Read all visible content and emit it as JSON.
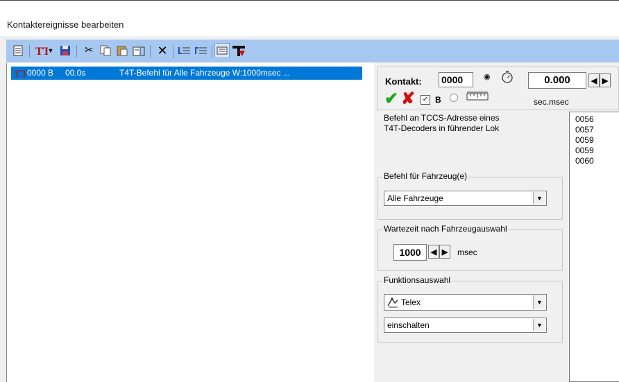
{
  "window": {
    "title": "Kontaktereignisse bearbeiten"
  },
  "toolbar": {
    "icons": [
      "new-doc-icon",
      "t4t-icon",
      "dropdown-icon",
      "save-icon",
      "cut-icon",
      "copy-icon",
      "paste-icon",
      "paste-special-icon",
      "delete-icon",
      "move-down-icon",
      "move-up-icon",
      "list-view-icon",
      "tv-logo-icon"
    ]
  },
  "event_list": {
    "selected_row": {
      "contact": "0000 B",
      "time": "00.0s",
      "description": "T4T-Befehl für Alle Fahrzeuge W:1000msec ..."
    }
  },
  "contact_panel": {
    "label": "Kontakt:",
    "contact_value": "0000",
    "b_label": "B",
    "time_value": "0.000",
    "time_unit": "sec.msec"
  },
  "description": {
    "line1": "Befehl an TCCS-Adresse eines",
    "line2": "T4T-Decoders in führender Lok"
  },
  "address_list": [
    "0056",
    "0057",
    "0059",
    "0059",
    "0060"
  ],
  "vehicle_group": {
    "legend": "Befehl für Fahrzeug(e)",
    "selected": "Alle Fahrzeuge"
  },
  "wait_group": {
    "legend": "Wartezeit nach Fahrzeugauswahl",
    "value": "1000",
    "unit": "msec"
  },
  "function_group": {
    "legend": "Funktionsauswahl",
    "function": "Telex",
    "action": "einschalten"
  },
  "colors": {
    "toolbar": "#a6c8f0",
    "selection": "#0078d7",
    "check": "#1aa51a",
    "cross": "#cc1111"
  }
}
